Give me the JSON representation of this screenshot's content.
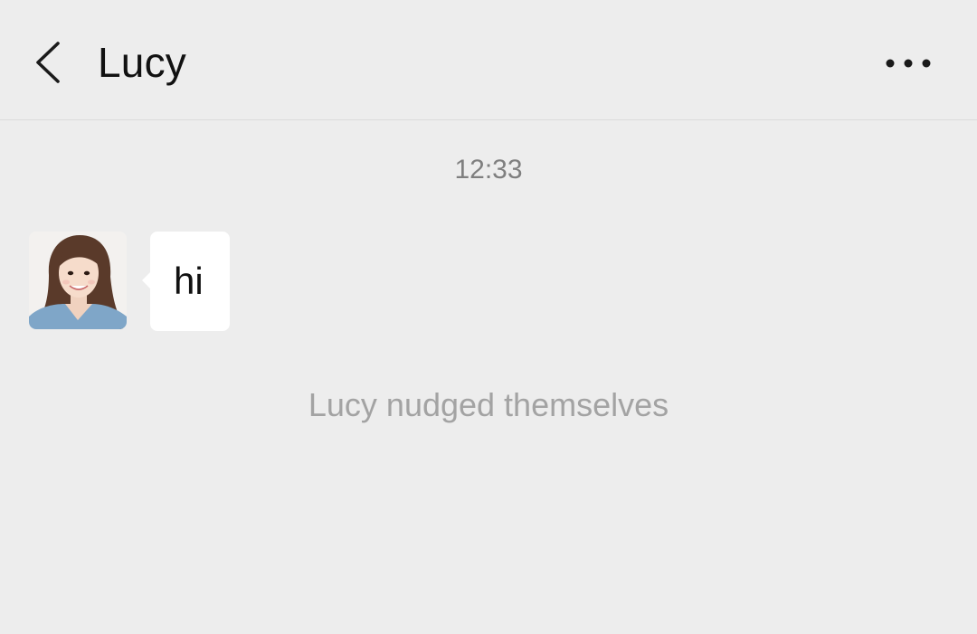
{
  "header": {
    "title": "Lucy",
    "back_icon": "chevron-left-icon",
    "more_icon": "more-dots-icon"
  },
  "chat": {
    "timestamp": "12:33",
    "messages": [
      {
        "sender": "Lucy",
        "avatar_icon": "contact-avatar",
        "text": "hi"
      }
    ],
    "system_message": "Lucy nudged themselves"
  },
  "colors": {
    "background": "#ededed",
    "bubble": "#ffffff",
    "timestamp_text": "#7f7f7f",
    "system_text": "#a3a3a3"
  }
}
